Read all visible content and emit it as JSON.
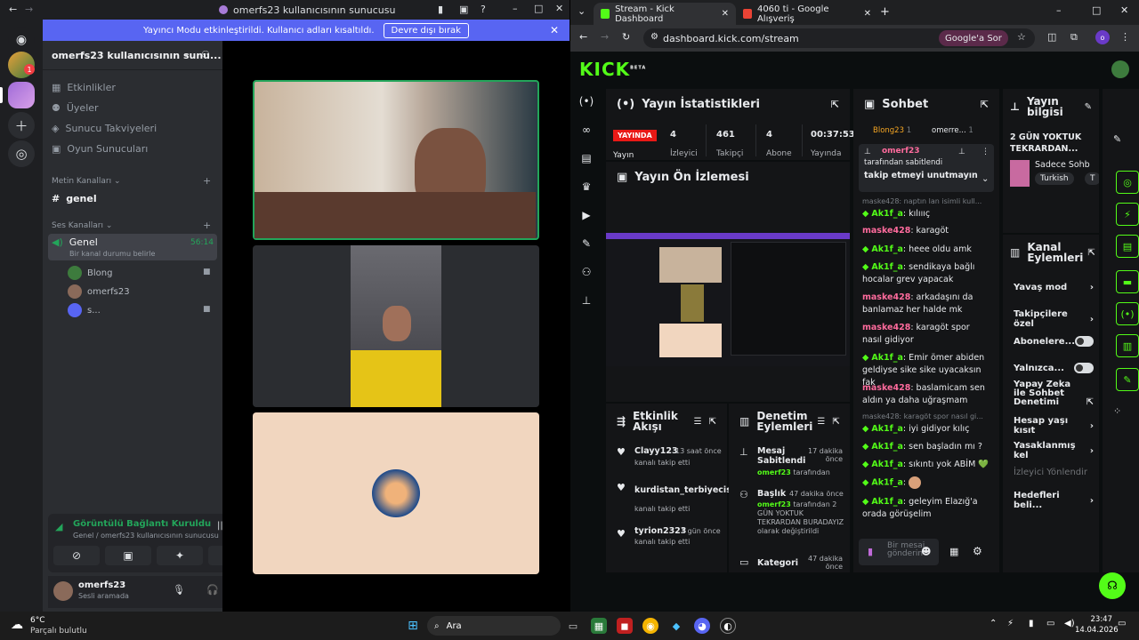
{
  "discord": {
    "window_title": "omerfs23 kullanıcısının sunucusu",
    "banner_text": "Yayıncı Modu etkinleştirildi. Kullanıcı adları kısaltıldı.",
    "banner_button": "Devre dışı bırak",
    "server_name": "omerfs23 kullanıcısının sunu...",
    "menu": [
      "Etkinlikler",
      "Üyeler",
      "Sunucu Takviyeleri",
      "Oyun Sunucuları"
    ],
    "text_category": "Metin Kanalları",
    "text_channel": "genel",
    "voice_category": "Ses Kanalları",
    "voice_channel": "Genel",
    "voice_time": "56:14",
    "voice_status": "Bir kanal durumu belirle",
    "voice_users": [
      "Blong",
      "omerfs23",
      "s..."
    ],
    "connection_title": "Görüntülü Bağlantı Kuruldu",
    "connection_sub": "Genel / omerfs23 kullanıcısının sunucusu",
    "user_name": "omerfs23",
    "user_status": "Sesli aramada",
    "guild_badge": "1"
  },
  "chrome": {
    "tab1": "Stream - Kick Dashboard",
    "tab2": "4060 ti - Google Alışveriş",
    "url": "dashboard.kick.com/stream",
    "google_btn": "Google'a Sor"
  },
  "kick": {
    "logo": "KICK",
    "logo_sup": "BETA",
    "stats_title": "Yayın İstatistikleri",
    "live_badge": "YAYINDA",
    "stats": [
      {
        "value": "4",
        "label": "İzleyici"
      },
      {
        "value": "461",
        "label": "Takipçi"
      },
      {
        "value": "4",
        "label": "Abone"
      },
      {
        "value": "00:37:53",
        "label": "Yayında"
      }
    ],
    "stats_partial": "Yayın",
    "preview_title": "Yayın Ön İzlemesi",
    "chat_title": "Sohbet",
    "chat_viewers": [
      {
        "name": "Blong23",
        "count": "1"
      },
      {
        "name": "omerre...",
        "count": "1"
      }
    ],
    "pinned_user": "omerf23",
    "pinned_by": "tarafından sabitlendi",
    "pinned_msg": "takip etmeyi unutmayın",
    "messages": [
      {
        "reply": "maske428: naptın lan isimli kull...",
        "user": "Ak1f_a",
        "text": "kılıııç"
      },
      {
        "user": "maske428",
        "text": "karagöt"
      },
      {
        "user": "Ak1f_a",
        "text": "heee oldu amk"
      },
      {
        "user": "Ak1f_a",
        "text": "sendikaya bağlı hocalar grev yapacak"
      },
      {
        "user": "maske428",
        "text": "arkadaşını da banlamaz her halde mk"
      },
      {
        "user": "maske428",
        "text": "karagöt spor nasıl gidiyor"
      },
      {
        "user": "Ak1f_a",
        "text": "Emir ömer abiden geldiyse sike sike uyacaksın fak"
      },
      {
        "user": "maske428",
        "text": "baslamicam sen aldın ya daha uğraşmam"
      },
      {
        "reply": "maske428: karagöt spor nasıl gi...",
        "user": "Ak1f_a",
        "text": "iyi gidiyor kılıç"
      },
      {
        "user": "Ak1f_a",
        "text": "sen başladın mı ?"
      },
      {
        "user": "Ak1f_a",
        "text": "sıkıntı yok ABİM 💚"
      },
      {
        "user": "Ak1f_a",
        "text": ""
      },
      {
        "user": "Ak1f_a",
        "text": "geleyim Elazığ'a orada görüşelim"
      }
    ],
    "chat_placeholder": "Bir mesaj gönderin",
    "info_title": "Yayın bilgisi",
    "info_stream_title": "2 GÜN YOKTUK TEKRARDAN...",
    "info_category": "Sadece Sohb",
    "info_tag": "Turkish",
    "info_tag2": "T",
    "actions_title": "Kanal Eylemleri",
    "actions": [
      "Yavaş mod",
      "Takipçilere özel",
      "Abonelere...",
      "Yalnızca...",
      "Yapay Zeka ile Sohbet Denetimi",
      "Hesap yaşı kısıt",
      "Yasaklanmış kel",
      "İzleyici Yönlendir",
      "Hedefleri beli..."
    ],
    "activity_title": "Etkinlik Akışı",
    "activity": [
      {
        "name": "Clayy123",
        "time": "13 saat önce",
        "sub": "kanalı takip etti"
      },
      {
        "name": "kurdistan_terbiyecisi",
        "time": "",
        "sub": "kanalı takip etti"
      },
      {
        "name": "tyrion2323",
        "time": "1 gün önce",
        "sub": "kanalı takip etti"
      }
    ],
    "mod_title": "Denetim Eylemleri",
    "mod": [
      {
        "title": "Mesaj Sabitlendi",
        "time": "17 dakika önce",
        "by": "omerf23",
        "desc": "tarafından"
      },
      {
        "title": "Başlık",
        "time": "47 dakika önce",
        "by": "omerf23",
        "desc": "tarafından 2 GÜN YOKTUK TEKRARDAN BURADAYIZ olarak değiştirildi"
      },
      {
        "title": "Kategori",
        "time": "47 dakika önce",
        "by": "",
        "desc": ""
      }
    ]
  },
  "taskbar": {
    "weather_temp": "6°C",
    "weather_desc": "Parçalı bulutlu",
    "search": "Ara",
    "time": "23:47",
    "date": "14.04.2026"
  }
}
